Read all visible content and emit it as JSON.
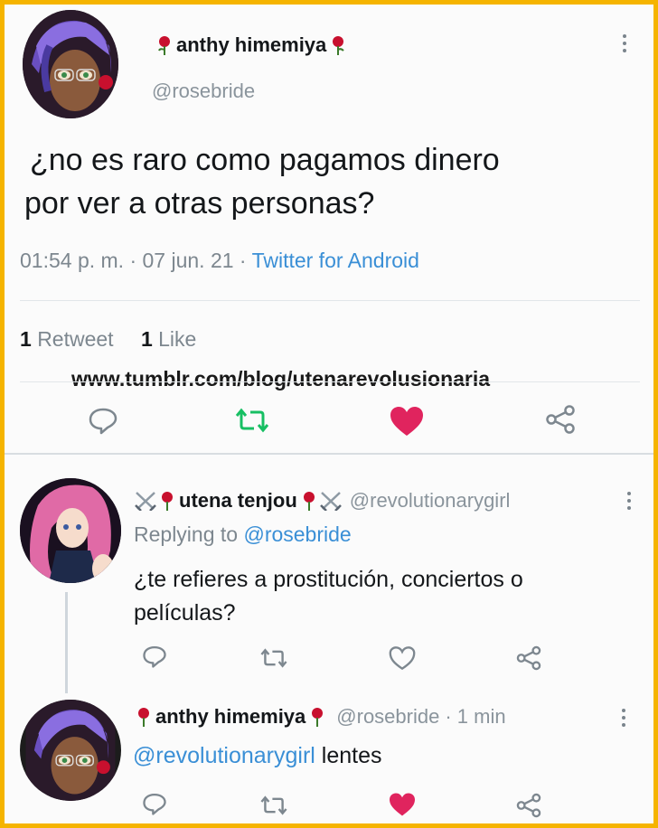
{
  "main_tweet": {
    "display_name": "anthy himemiya",
    "handle": "@rosebride",
    "text_line1": "¿no es raro como pagamos dinero",
    "text_line2": "por ver a otras personas?",
    "time": "01:54 p. m. · 07 jun. 21 · ",
    "source": "Twitter for Android",
    "retweet_count": "1",
    "retweet_label": "Retweet",
    "like_count": "1",
    "like_label": "Like",
    "watermark": "www.tumblr.com/blog/utenarevolusionaria"
  },
  "reply1": {
    "display_name": "utena tenjou",
    "handle": "@revolutionarygirl",
    "replying_prefix": "Replying to ",
    "replying_handle": "@rosebride",
    "text_line1": "¿te refieres a prostitución, conciertos o",
    "text_line2": "películas?"
  },
  "reply2": {
    "display_name": "anthy himemiya",
    "handle": "@rosebride",
    "time": "· 1 min",
    "mention": "@revolutionarygirl",
    "text": " lentes"
  },
  "colors": {
    "border": "#f5b400",
    "retweet_green": "#17bf63",
    "like_red": "#e0245e",
    "link_blue": "#3a8fd6",
    "rose_red": "#c8102e"
  },
  "icons": [
    "rose-icon",
    "crossed-swords-icon",
    "more-options-icon",
    "reply-icon",
    "retweet-icon",
    "like-icon",
    "share-icon"
  ]
}
